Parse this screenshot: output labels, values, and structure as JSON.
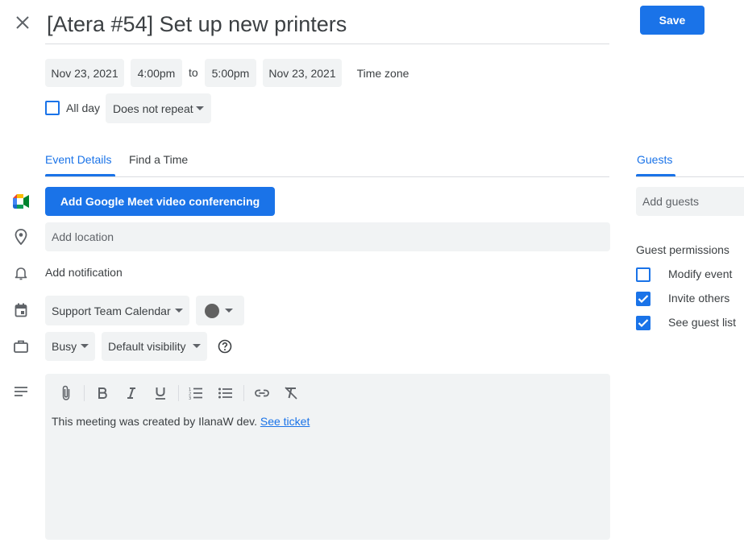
{
  "title": "[Atera #54] Set up new printers",
  "save_label": "Save",
  "when": {
    "start_date": "Nov 23, 2021",
    "start_time": "4:00pm",
    "to_label": "to",
    "end_time": "5:00pm",
    "end_date": "Nov 23, 2021",
    "timezone_label": "Time zone",
    "all_day_label": "All day",
    "repeat_value": "Does not repeat"
  },
  "tabs": [
    {
      "label": "Event Details",
      "active": true
    },
    {
      "label": "Find a Time",
      "active": false
    }
  ],
  "details": {
    "meet_button_label": "Add Google Meet video conferencing",
    "location_placeholder": "Add location",
    "notification_label": "Add notification",
    "calendar_value": "Support Team Calendar",
    "calendar_color": "#616161",
    "busy_value": "Busy",
    "visibility_value": "Default visibility",
    "description_text": "This meeting was created by IlanaW dev.",
    "description_link": "See ticket"
  },
  "guests": {
    "tab_label": "Guests",
    "add_placeholder": "Add guests",
    "permissions_title": "Guest permissions",
    "permissions": [
      {
        "label": "Modify event",
        "checked": false
      },
      {
        "label": "Invite others",
        "checked": true
      },
      {
        "label": "See guest list",
        "checked": true
      }
    ]
  },
  "colors": {
    "accent": "#1a73e8",
    "chip_bg": "#f1f3f4",
    "text": "#3c4043",
    "secondary": "#5f6368"
  }
}
